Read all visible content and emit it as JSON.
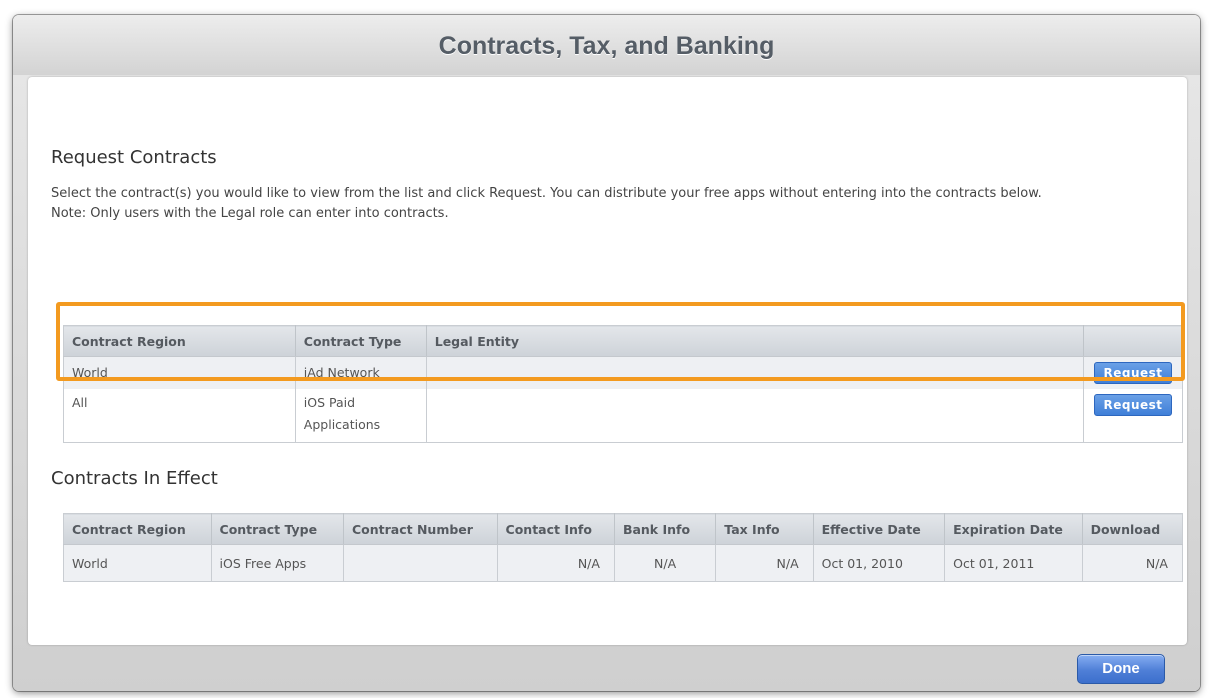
{
  "window": {
    "title": "Contracts, Tax, and Banking",
    "done_label": "Done"
  },
  "request": {
    "heading": "Request Contracts",
    "description": "Select the contract(s) you would like to view from the list and click Request. You can distribute your free apps without entering into the contracts below.",
    "note": "Note: Only users with the Legal role can enter into contracts.",
    "columns": [
      "Contract Region",
      "Contract Type",
      "Legal Entity",
      ""
    ],
    "rows": [
      {
        "region": "World",
        "type": "iAd Network",
        "entity": "",
        "action": "Request"
      },
      {
        "region": "All",
        "type": "iOS Paid Applications",
        "entity": "",
        "action": "Request"
      }
    ]
  },
  "effect": {
    "heading": "Contracts In Effect",
    "columns": [
      "Contract Region",
      "Contract Type",
      "Contract Number",
      "Contact Info",
      "Bank Info",
      "Tax Info",
      "Effective Date",
      "Expiration Date",
      "Download"
    ],
    "rows": [
      {
        "region": "World",
        "type": "iOS Free Apps",
        "number": "",
        "contact": "N/A",
        "bank": "N/A",
        "tax": "N/A",
        "effective": "Oct 01, 2010",
        "expiration": "Oct 01, 2011",
        "download": "N/A"
      }
    ]
  },
  "colors": {
    "highlight": "#f39a1f",
    "button_blue": "#3f7fd8"
  }
}
